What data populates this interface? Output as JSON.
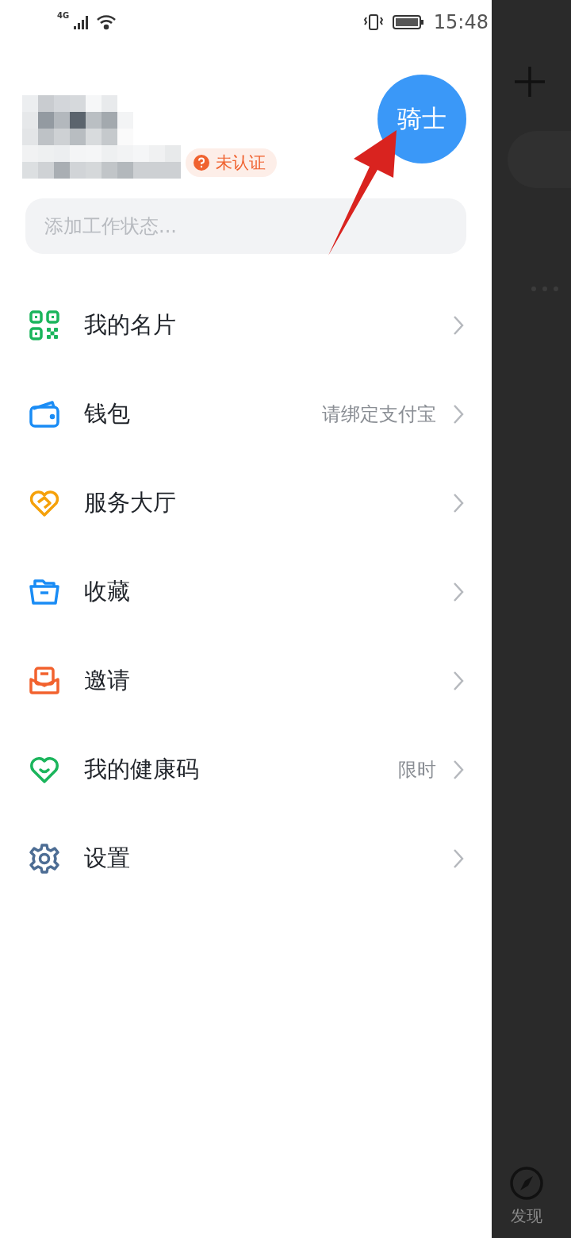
{
  "status_bar": {
    "network": "4G",
    "time": "15:48"
  },
  "profile": {
    "badge": "未认证",
    "avatar": "骑士"
  },
  "status_field": {
    "placeholder": "添加工作状态..."
  },
  "menu": [
    {
      "kind": "qr",
      "label": "我的名片"
    },
    {
      "kind": "wallet",
      "label": "钱包",
      "note": "请绑定支付宝"
    },
    {
      "kind": "service",
      "label": "服务大厅"
    },
    {
      "kind": "favorites",
      "label": "收藏"
    },
    {
      "kind": "invite",
      "label": "邀请"
    },
    {
      "kind": "health",
      "label": "我的健康码",
      "note": "限时"
    },
    {
      "kind": "settings",
      "label": "设置"
    }
  ],
  "background": {
    "nav_label": "发现"
  }
}
